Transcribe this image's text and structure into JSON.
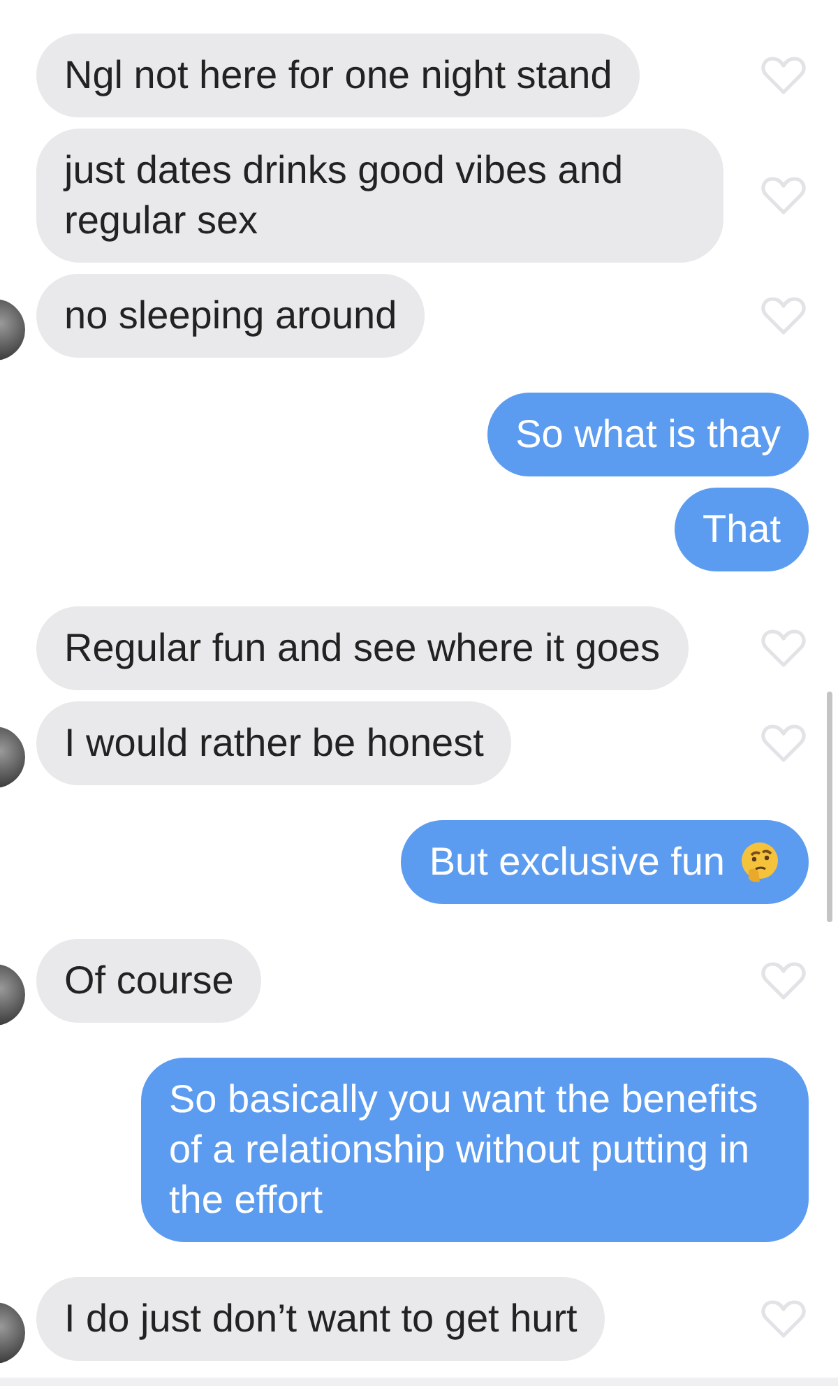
{
  "messages": [
    {
      "kind": "received",
      "text": "Ngl not here for one night stand",
      "avatar": false,
      "liked": false
    },
    {
      "kind": "received",
      "text": "just dates drinks good vibes and regular sex",
      "avatar": false,
      "liked": false
    },
    {
      "kind": "received",
      "text": "no sleeping around",
      "avatar": true,
      "liked": false
    },
    {
      "kind": "sent",
      "text": "So what is thay"
    },
    {
      "kind": "sent",
      "text": "That"
    },
    {
      "kind": "received",
      "text": "Regular fun and see where it goes",
      "avatar": false,
      "liked": false
    },
    {
      "kind": "received",
      "text": "I would rather be honest",
      "avatar": true,
      "liked": false
    },
    {
      "kind": "sent",
      "text": "But exclusive fun",
      "thinking_emoji": true
    },
    {
      "kind": "received",
      "text": "Of course",
      "avatar": true,
      "liked": false
    },
    {
      "kind": "sent",
      "text": "So basically you want the benefits of a relationship without putting in the effort"
    },
    {
      "kind": "received",
      "text": "I do just don’t want to get hurt",
      "avatar": true,
      "liked": false
    }
  ]
}
